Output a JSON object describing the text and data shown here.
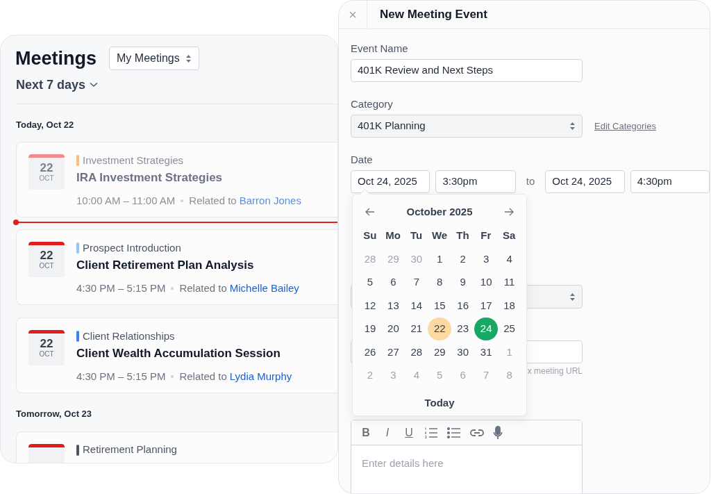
{
  "meetings_panel": {
    "title": "Meetings",
    "filter_select": {
      "value": "My Meetings"
    },
    "range": "Next 7 days",
    "groups": [
      {
        "heading": "Today, Oct 22",
        "meetings": [
          {
            "day": "22",
            "month": "OCT",
            "category": "Investment Strategies",
            "color": "#fbbf77",
            "title": "IRA Investment Strategies",
            "time": "10:00 AM – 11:00 AM",
            "related_label": "Related to",
            "related_name": "Barron Jones",
            "past": true,
            "now_line_after": true
          },
          {
            "day": "22",
            "month": "OCT",
            "category": "Prospect Introduction",
            "color": "#93c5fd",
            "title": "Client Retirement Plan Analysis",
            "time": "4:30 PM – 5:15 PM",
            "related_label": "Related to",
            "related_name": "Michelle Bailey",
            "past": false,
            "now_line_after": false
          },
          {
            "day": "22",
            "month": "OCT",
            "category": "Client Relationships",
            "color": "#3b82f6",
            "title": "Client Wealth Accumulation Session",
            "time": "4:30 PM – 5:15 PM",
            "related_label": "Related to",
            "related_name": "Lydia Murphy",
            "past": false,
            "now_line_after": false
          }
        ]
      },
      {
        "heading": "Tomorrow, Oct 23",
        "meetings": [
          {
            "category": "Retirement Planning",
            "color": "#4b5563",
            "past": false,
            "now_line_after": false
          }
        ]
      }
    ]
  },
  "event_form": {
    "close": "×",
    "title": "New Meeting Event",
    "event_name": {
      "label": "Event Name",
      "value": "401K Review and Next Steps"
    },
    "category": {
      "label": "Category",
      "value": "401K Planning",
      "link": "Edit Categories"
    },
    "date": {
      "label": "Date",
      "start_date": "Oct 24, 2025",
      "start_time": "3:30pm",
      "separator": "to",
      "end_date": "Oct 24, 2025",
      "end_time": "4:30pm"
    },
    "covered_hint": "x meeting URL",
    "date_picker": {
      "month": "October 2025",
      "weekdays": [
        "Su",
        "Mo",
        "Tu",
        "We",
        "Th",
        "Fr",
        "Sa"
      ],
      "days": [
        {
          "label": "28",
          "muted": true,
          "today": false,
          "selected": false
        },
        {
          "label": "29",
          "muted": true,
          "today": false,
          "selected": false
        },
        {
          "label": "30",
          "muted": true,
          "today": false,
          "selected": false
        },
        {
          "label": "1",
          "muted": false,
          "today": false,
          "selected": false
        },
        {
          "label": "2",
          "muted": false,
          "today": false,
          "selected": false
        },
        {
          "label": "3",
          "muted": false,
          "today": false,
          "selected": false
        },
        {
          "label": "4",
          "muted": false,
          "today": false,
          "selected": false
        },
        {
          "label": "5",
          "muted": false,
          "today": false,
          "selected": false
        },
        {
          "label": "6",
          "muted": false,
          "today": false,
          "selected": false
        },
        {
          "label": "7",
          "muted": false,
          "today": false,
          "selected": false
        },
        {
          "label": "8",
          "muted": false,
          "today": false,
          "selected": false
        },
        {
          "label": "9",
          "muted": false,
          "today": false,
          "selected": false
        },
        {
          "label": "10",
          "muted": false,
          "today": false,
          "selected": false
        },
        {
          "label": "11",
          "muted": false,
          "today": false,
          "selected": false
        },
        {
          "label": "12",
          "muted": false,
          "today": false,
          "selected": false
        },
        {
          "label": "13",
          "muted": false,
          "today": false,
          "selected": false
        },
        {
          "label": "14",
          "muted": false,
          "today": false,
          "selected": false
        },
        {
          "label": "15",
          "muted": false,
          "today": false,
          "selected": false
        },
        {
          "label": "16",
          "muted": false,
          "today": false,
          "selected": false
        },
        {
          "label": "17",
          "muted": false,
          "today": false,
          "selected": false
        },
        {
          "label": "18",
          "muted": false,
          "today": false,
          "selected": false
        },
        {
          "label": "19",
          "muted": false,
          "today": false,
          "selected": false
        },
        {
          "label": "20",
          "muted": false,
          "today": false,
          "selected": false
        },
        {
          "label": "21",
          "muted": false,
          "today": false,
          "selected": false
        },
        {
          "label": "22",
          "muted": false,
          "today": true,
          "selected": false
        },
        {
          "label": "23",
          "muted": false,
          "today": false,
          "selected": false
        },
        {
          "label": "24",
          "muted": false,
          "today": false,
          "selected": true
        },
        {
          "label": "25",
          "muted": false,
          "today": false,
          "selected": false
        },
        {
          "label": "26",
          "muted": false,
          "today": false,
          "selected": false
        },
        {
          "label": "27",
          "muted": false,
          "today": false,
          "selected": false
        },
        {
          "label": "28",
          "muted": false,
          "today": false,
          "selected": false
        },
        {
          "label": "29",
          "muted": false,
          "today": false,
          "selected": false
        },
        {
          "label": "30",
          "muted": false,
          "today": false,
          "selected": false
        },
        {
          "label": "31",
          "muted": false,
          "today": false,
          "selected": false
        },
        {
          "label": "1",
          "muted": true,
          "today": false,
          "selected": false
        },
        {
          "label": "2",
          "muted": true,
          "today": false,
          "selected": false
        },
        {
          "label": "3",
          "muted": true,
          "today": false,
          "selected": false
        },
        {
          "label": "4",
          "muted": true,
          "today": false,
          "selected": false
        },
        {
          "label": "5",
          "muted": true,
          "today": false,
          "selected": false
        },
        {
          "label": "6",
          "muted": true,
          "today": false,
          "selected": false
        },
        {
          "label": "7",
          "muted": true,
          "today": false,
          "selected": false
        },
        {
          "label": "8",
          "muted": true,
          "today": false,
          "selected": false
        }
      ],
      "today_button": "Today"
    },
    "details_editor": {
      "format_buttons": [
        {
          "label": "B",
          "kind": "bold"
        },
        {
          "label": "I",
          "kind": "italic"
        },
        {
          "label": "U",
          "kind": "underline"
        }
      ],
      "placeholder": "Enter details here"
    }
  }
}
